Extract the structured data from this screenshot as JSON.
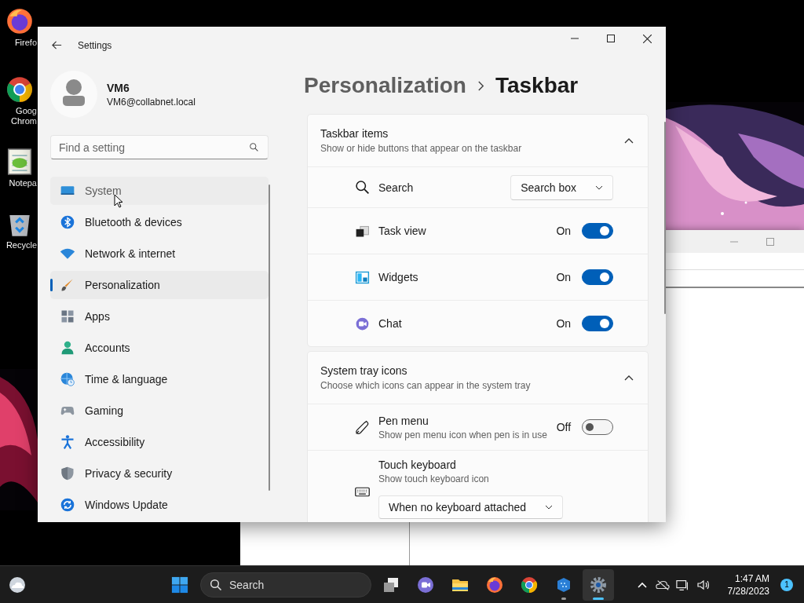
{
  "desktop": {
    "icons": [
      {
        "kind": "firefox",
        "lines": [
          "Firefo"
        ]
      },
      {
        "kind": "chrome",
        "lines": [
          "Goog",
          "Chrom"
        ]
      },
      {
        "kind": "notepad",
        "lines": [
          "Notepa"
        ]
      },
      {
        "kind": "recycle",
        "lines": [
          "Recycle"
        ]
      }
    ]
  },
  "window": {
    "title": "Settings"
  },
  "account": {
    "name": "VM6",
    "email": "VM6@collabnet.local"
  },
  "search": {
    "placeholder": "Find a setting"
  },
  "nav": [
    {
      "label": "System",
      "selected": false,
      "hovered": true
    },
    {
      "label": "Bluetooth & devices",
      "selected": false,
      "hovered": false
    },
    {
      "label": "Network & internet",
      "selected": false,
      "hovered": false
    },
    {
      "label": "Personalization",
      "selected": true,
      "hovered": false
    },
    {
      "label": "Apps",
      "selected": false,
      "hovered": false
    },
    {
      "label": "Accounts",
      "selected": false,
      "hovered": false
    },
    {
      "label": "Time & language",
      "selected": false,
      "hovered": false
    },
    {
      "label": "Gaming",
      "selected": false,
      "hovered": false
    },
    {
      "label": "Accessibility",
      "selected": false,
      "hovered": false
    },
    {
      "label": "Privacy & security",
      "selected": false,
      "hovered": false
    },
    {
      "label": "Windows Update",
      "selected": false,
      "hovered": false
    }
  ],
  "breadcrumb": {
    "parent": "Personalization",
    "current": "Taskbar"
  },
  "sections": [
    {
      "title": "Taskbar items",
      "subtitle": "Show or hide buttons that appear on the taskbar",
      "expanded": true,
      "rows": [
        {
          "kind": "dropdown",
          "label": "Search",
          "value": "Search box"
        },
        {
          "kind": "toggle",
          "label": "Task view",
          "state_text": "On",
          "on": true
        },
        {
          "kind": "toggle",
          "label": "Widgets",
          "state_text": "On",
          "on": true
        },
        {
          "kind": "toggle",
          "label": "Chat",
          "state_text": "On",
          "on": true
        }
      ]
    },
    {
      "title": "System tray icons",
      "subtitle": "Choose which icons can appear in the system tray",
      "expanded": true,
      "rows": [
        {
          "kind": "toggle",
          "label": "Pen menu",
          "description": "Show pen menu icon when pen is in use",
          "state_text": "Off",
          "on": false
        },
        {
          "kind": "dropdown_below",
          "label": "Touch keyboard",
          "description": "Show touch keyboard icon",
          "value": "When no keyboard attached"
        }
      ]
    }
  ],
  "taskbar": {
    "search_placeholder": "Search",
    "apps": [
      {
        "kind": "taskview",
        "running": false,
        "selected": false
      },
      {
        "kind": "chat",
        "running": false,
        "selected": false
      },
      {
        "kind": "explorer",
        "running": false,
        "selected": false
      },
      {
        "kind": "firefox",
        "running": false,
        "selected": false
      },
      {
        "kind": "chrome",
        "running": false,
        "selected": false
      },
      {
        "kind": "cube",
        "running": true,
        "selected": false
      },
      {
        "kind": "settings",
        "running": true,
        "selected": true
      }
    ],
    "time": "1:47 AM",
    "date": "7/28/2023",
    "notification_count": "1"
  }
}
